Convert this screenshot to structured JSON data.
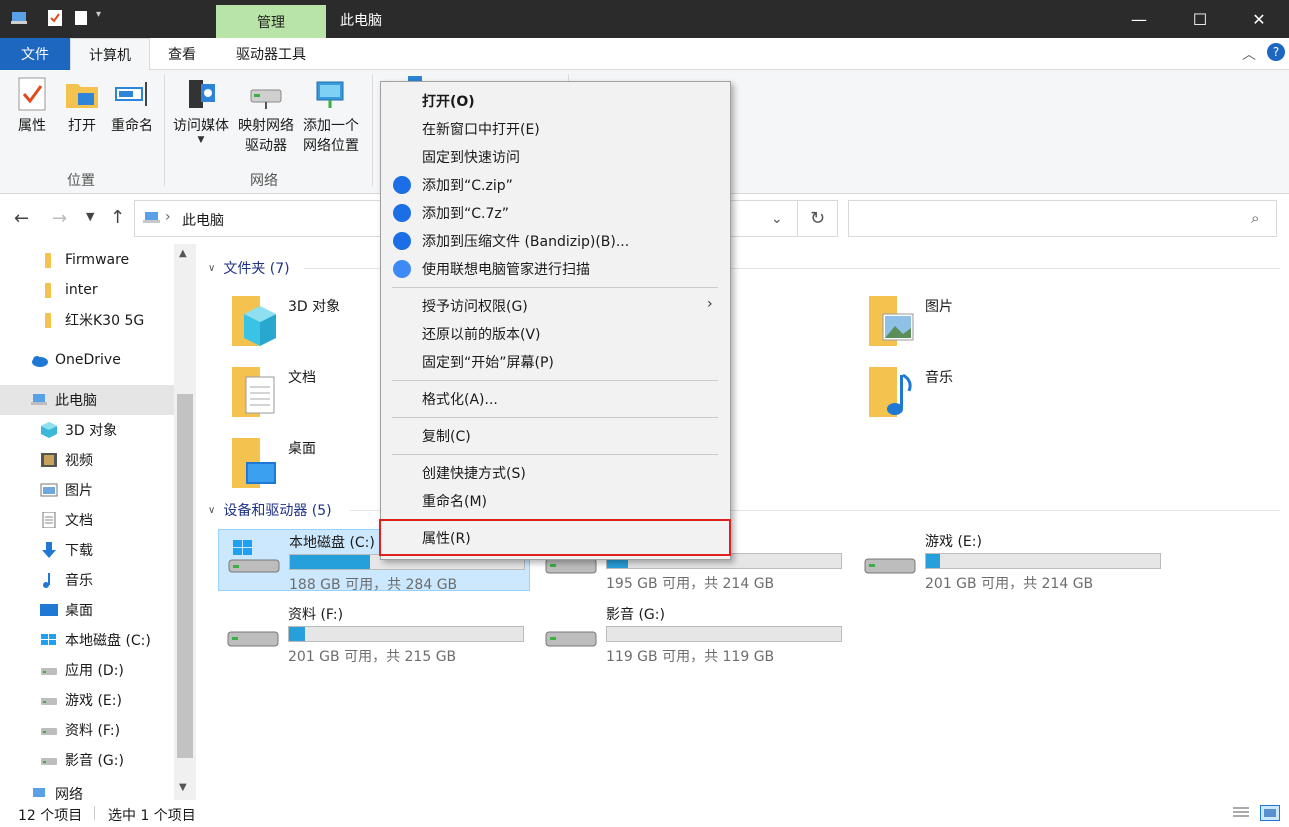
{
  "titlebar": {
    "manage_tab": "管理",
    "title": "此电脑",
    "minimize": "—",
    "maximize": "☐",
    "close": "✕"
  },
  "ribbon_tabs": {
    "file": "文件",
    "computer": "计算机",
    "view": "查看",
    "drive_tools": "驱动器工具"
  },
  "ribbon": {
    "properties": "属性",
    "open": "打开",
    "rename": "重命名",
    "location_group": "位置",
    "access_media_line1": "访问媒体",
    "map_drive_line1": "映射网络",
    "map_drive_line2": "驱动器",
    "add_location_line1": "添加一个",
    "add_location_line2": "网络位置",
    "network_group": "网络"
  },
  "address": {
    "path": "此电脑",
    "breadcrumb_sep": "›",
    "search_placeholder": ""
  },
  "nav": {
    "items": [
      {
        "label": "Firmware",
        "icon": "folder-icon"
      },
      {
        "label": "inter",
        "icon": "folder-icon"
      },
      {
        "label": "红米K30 5G",
        "icon": "folder-icon"
      },
      {
        "label": "OneDrive",
        "icon": "cloud-icon"
      },
      {
        "label": "此电脑",
        "icon": "computer-icon"
      },
      {
        "label": "3D 对象",
        "icon": "cube-icon"
      },
      {
        "label": "视频",
        "icon": "video-icon"
      },
      {
        "label": "图片",
        "icon": "picture-icon"
      },
      {
        "label": "文档",
        "icon": "document-icon"
      },
      {
        "label": "下载",
        "icon": "download-icon"
      },
      {
        "label": "音乐",
        "icon": "music-icon"
      },
      {
        "label": "桌面",
        "icon": "desktop-icon"
      },
      {
        "label": "本地磁盘 (C:)",
        "icon": "windows-drive-icon"
      },
      {
        "label": "应用 (D:)",
        "icon": "drive-icon"
      },
      {
        "label": "游戏 (E:)",
        "icon": "drive-icon"
      },
      {
        "label": "资料 (F:)",
        "icon": "drive-icon"
      },
      {
        "label": "影音 (G:)",
        "icon": "drive-icon"
      },
      {
        "label": "网络",
        "icon": "network-icon"
      }
    ]
  },
  "content": {
    "folders_header": "文件夹 (7)",
    "folders": [
      {
        "label": "3D 对象"
      },
      {
        "label": "文档"
      },
      {
        "label": "桌面"
      },
      {
        "label": "图片"
      },
      {
        "label": "音乐"
      }
    ],
    "drives_header": "设备和驱动器 (5)",
    "drives": [
      {
        "name": "本地磁盘 (C:)",
        "info": "188 GB 可用，共 284 GB",
        "used_fraction": 0.34
      },
      {
        "name": "",
        "info": "195 GB 可用，共 214 GB",
        "used_fraction": 0.09
      },
      {
        "name": "游戏 (E:)",
        "info": "201 GB 可用，共 214 GB",
        "used_fraction": 0.06
      },
      {
        "name": "资料 (F:)",
        "info": "201 GB 可用，共 215 GB",
        "used_fraction": 0.07
      },
      {
        "name": "影音 (G:)",
        "info": "119 GB 可用，共 119 GB",
        "used_fraction": 0.0
      }
    ]
  },
  "context_menu": {
    "open": "打开(O)",
    "open_new_window": "在新窗口中打开(E)",
    "pin_quick_access": "固定到快速访问",
    "add_zip": "添加到“C.zip”",
    "add_7z": "添加到“C.7z”",
    "add_archive": "添加到压缩文件 (Bandizip)(B)...",
    "lenovo_scan": "使用联想电脑管家进行扫描",
    "give_access": "授予访问权限(G)",
    "restore_versions": "还原以前的版本(V)",
    "pin_start": "固定到“开始”屏幕(P)",
    "format": "格式化(A)...",
    "copy": "复制(C)",
    "create_shortcut": "创建快捷方式(S)",
    "rename": "重命名(M)",
    "properties": "属性(R)"
  },
  "status": {
    "item_count": "12 个项目",
    "selected": "选中 1 个项目"
  },
  "colors": {
    "accent": "#1e67c0",
    "manage_tab": "#b9e4a8",
    "drive_bar": "#26a0da",
    "highlight_border": "#e0201e",
    "selection": "#cce8ff"
  }
}
